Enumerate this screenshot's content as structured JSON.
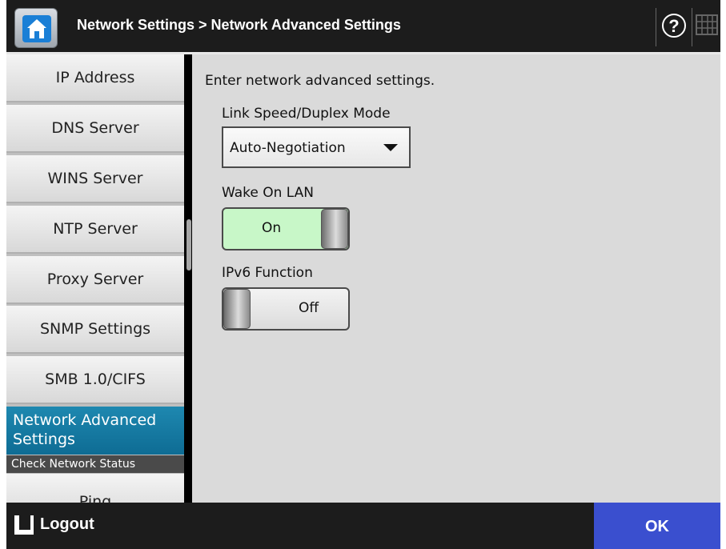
{
  "header": {
    "breadcrumb": "Network Settings > Network Advanced Settings",
    "home_icon": "home-icon",
    "help_icon": "help-icon",
    "help_glyph": "?",
    "keyboard_icon": "keyboard-icon"
  },
  "sidebar": {
    "items": [
      {
        "label": "IP Address"
      },
      {
        "label": "DNS Server"
      },
      {
        "label": "WINS Server"
      },
      {
        "label": "NTP Server"
      },
      {
        "label": "Proxy Server"
      },
      {
        "label": "SNMP Settings"
      },
      {
        "label": "SMB 1.0/CIFS"
      }
    ],
    "active_item": "Network Advanced Settings",
    "section_header": "Check Network Status",
    "ping_item": "Ping"
  },
  "main": {
    "instruction": "Enter network advanced settings.",
    "link_speed": {
      "label": "Link Speed/Duplex Mode",
      "value": "Auto-Negotiation"
    },
    "wake_on_lan": {
      "label": "Wake On LAN",
      "value": "On"
    },
    "ipv6": {
      "label": "IPv6 Function",
      "value": "Off"
    }
  },
  "footer": {
    "logout_label": "Logout",
    "ok_label": "OK"
  },
  "colors": {
    "active_item": "#1478a4",
    "toggle_on": "#c8f7c8",
    "ok_button": "#3a4fcf"
  }
}
